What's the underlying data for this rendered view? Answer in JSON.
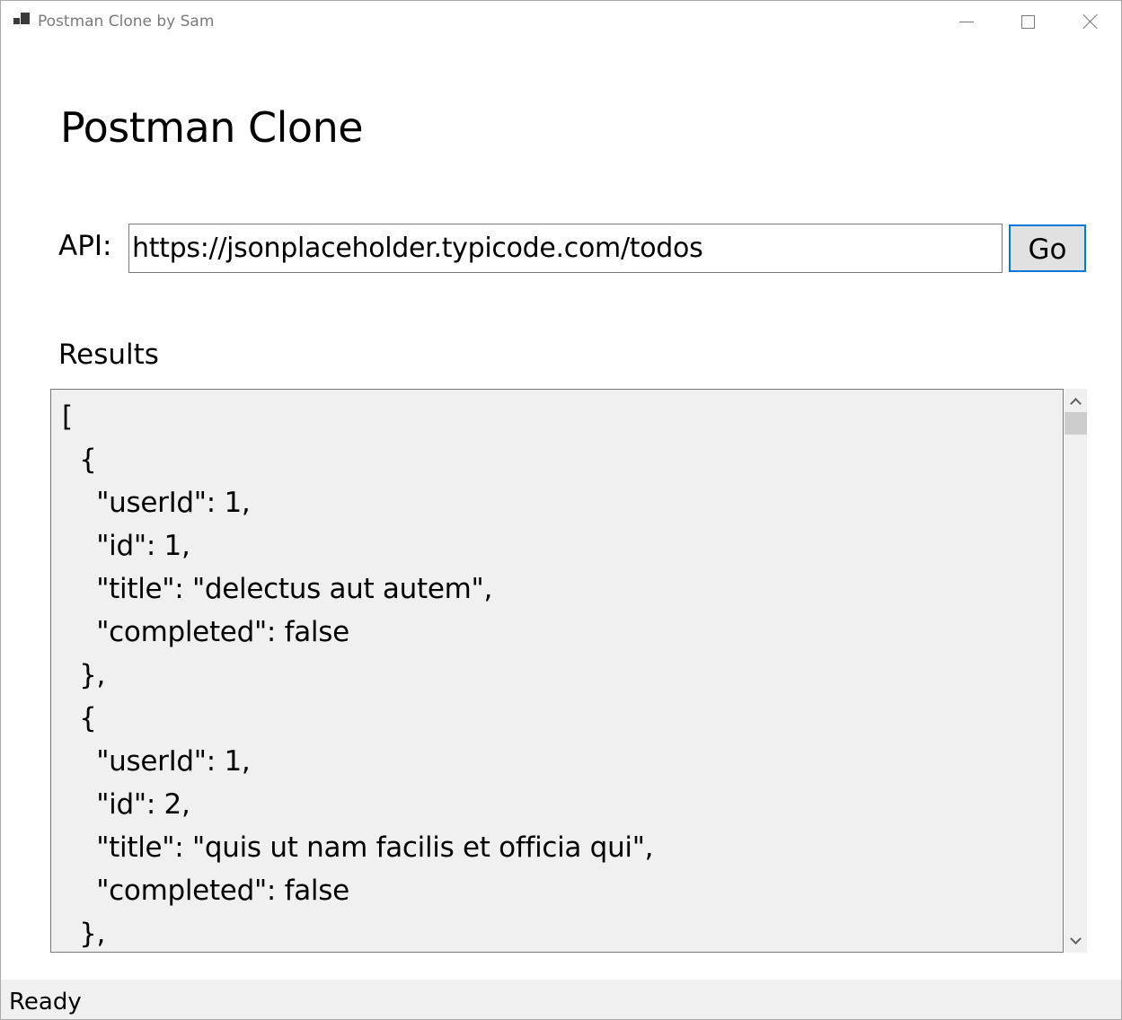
{
  "window": {
    "title": "Postman Clone by Sam"
  },
  "header": {
    "title": "Postman Clone"
  },
  "api": {
    "label": "API:",
    "url": "https://jsonplaceholder.typicode.com/todos",
    "go_label": "Go"
  },
  "results": {
    "label": "Results",
    "text": "[\n  {\n    \"userId\": 1,\n    \"id\": 1,\n    \"title\": \"delectus aut autem\",\n    \"completed\": false\n  },\n  {\n    \"userId\": 1,\n    \"id\": 2,\n    \"title\": \"quis ut nam facilis et officia qui\",\n    \"completed\": false\n  },"
  },
  "status": {
    "text": "Ready"
  },
  "icons": {
    "app": "app-window-icon",
    "minimize": "minimize-icon",
    "maximize": "maximize-icon",
    "close": "close-icon",
    "scroll_up": "chevron-up-icon",
    "scroll_down": "chevron-down-icon"
  },
  "colors": {
    "accent": "#0078d7",
    "results_background": "#f0f0f0",
    "button_background": "#e1e1e1"
  }
}
